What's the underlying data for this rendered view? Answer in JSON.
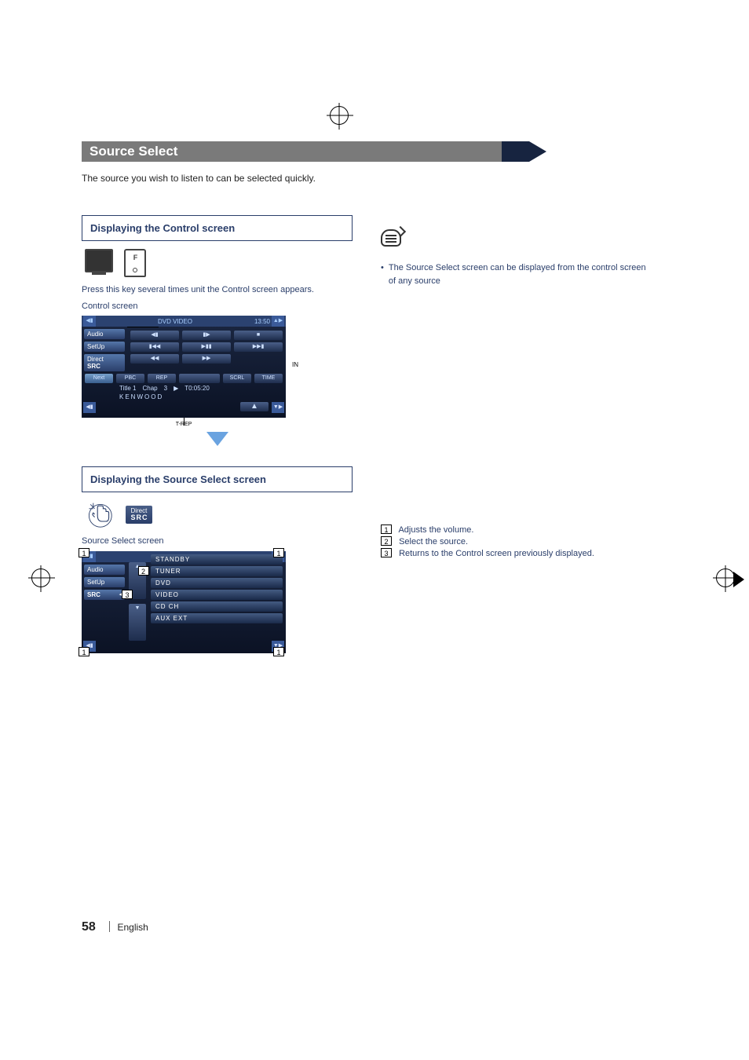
{
  "section_title": "Source Select",
  "intro": "The source you wish to listen to can be selected quickly.",
  "box1": {
    "title": "Displaying the Control screen",
    "remote_key": "F",
    "instruction": "Press this key several times unit the Control screen appears.",
    "caption": "Control screen"
  },
  "control_shot": {
    "header": "DVD VIDEO",
    "clock": "13:50",
    "side": {
      "audio": "Audio",
      "setup": "SetUp",
      "dsrc_top": "Direct",
      "dsrc_bot": "SRC"
    },
    "in_label": "IN",
    "row3": {
      "next": "Next",
      "pbc": "PBC",
      "rep": "REP",
      "scrl": "SCRL",
      "time": "TIME"
    },
    "info": {
      "title": "Title  1",
      "chap": "Chap",
      "chapnum": "3",
      "play": "▶",
      "t": "T0:05:20",
      "brand": "KENWOOD"
    },
    "trep": "T-REP",
    "eject": "▲"
  },
  "box2": {
    "title": "Displaying the Source Select screen",
    "btn_top": "Direct",
    "btn_bot": "SRC",
    "caption": "Source Select screen"
  },
  "source_shot": {
    "side": {
      "audio": "Audio",
      "setup": "SetUp",
      "src": "SRC"
    },
    "standby": "STANDBY",
    "tuner": "TUNER",
    "dvd": "DVD",
    "video": "VIDEO",
    "cdch": "CD CH",
    "aux": "AUX EXT",
    "up": "▲",
    "down": "▼"
  },
  "note": {
    "bullet": "•",
    "text": "The Source Select screen can be displayed from the control screen of any source"
  },
  "legend": {
    "l1": "Adjusts the volume.",
    "l2": "Select the source.",
    "l3": "Returns to the Control screen previously displayed."
  },
  "callouts": {
    "n1": "1",
    "n2": "2",
    "n3": "3"
  },
  "footer": {
    "page": "58",
    "lang": "English"
  }
}
